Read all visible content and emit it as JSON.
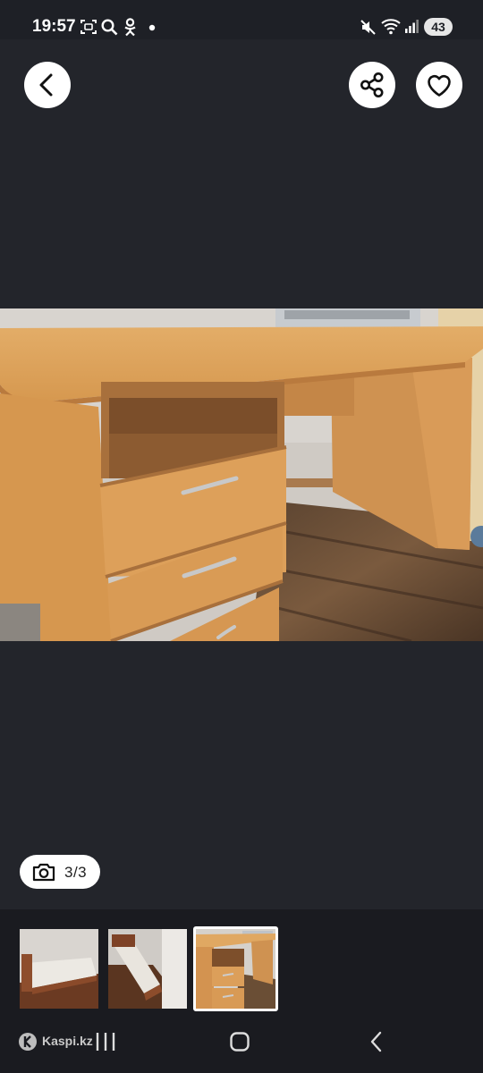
{
  "status_bar": {
    "time": "19:57",
    "left_icons": [
      "screenshot-icon",
      "search-icon",
      "odnoklassniki-icon",
      "dot-icon"
    ],
    "right_icons": [
      "mute-icon",
      "wifi-icon",
      "signal-icon"
    ],
    "battery": "43"
  },
  "viewer": {
    "back_icon": "chevron-left-icon",
    "share_icon": "share-icon",
    "favorite_icon": "heart-icon",
    "photo": "wooden-desk-photo",
    "counter": "3/3",
    "counter_icon": "camera-icon"
  },
  "thumbnails": [
    {
      "name": "bed-photo-1",
      "selected": false
    },
    {
      "name": "bed-photo-2",
      "selected": false
    },
    {
      "name": "desk-photo",
      "selected": true
    }
  ],
  "watermark": "Kaspi.kz",
  "nav_bar": {
    "recent_icon": "recent-apps-icon",
    "home_icon": "home-icon",
    "back_icon": "back-icon"
  },
  "colors": {
    "background": "#23252b",
    "strip": "#1a1b20",
    "desk": "#d9a15a"
  }
}
